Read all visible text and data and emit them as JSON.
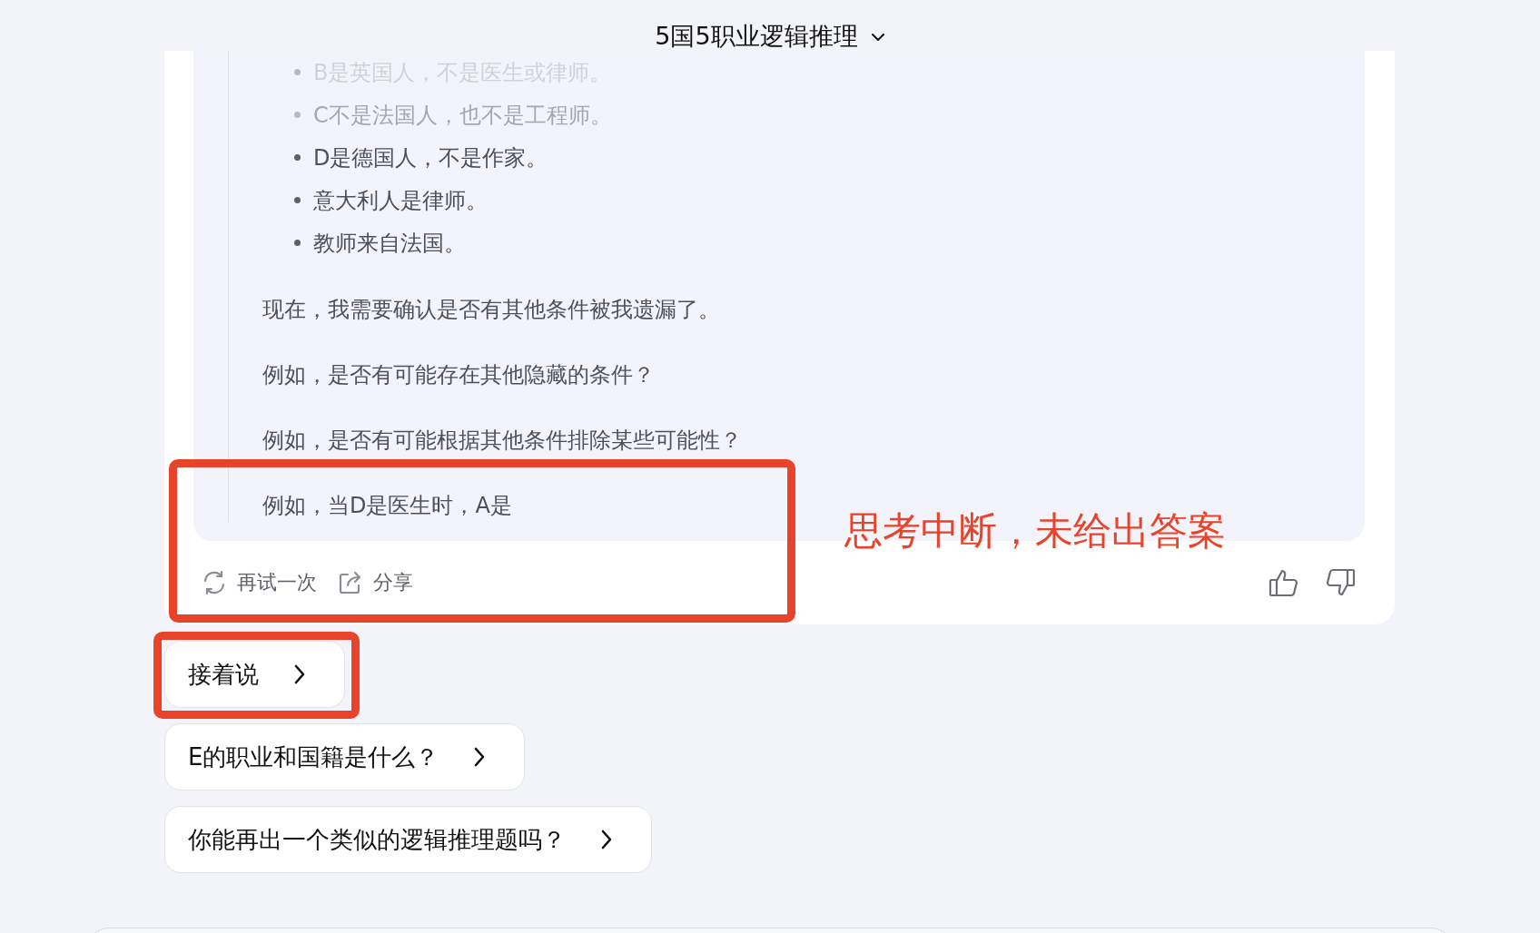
{
  "header": {
    "title": "5国5职业逻辑推理"
  },
  "thinking": {
    "bullets": [
      {
        "text": "B是英国人，不是医生或律师。",
        "faded": true
      },
      {
        "text": "C不是法国人，也不是工程师。",
        "faded": true
      },
      {
        "text": "D是德国人，不是作家。",
        "faded": false
      },
      {
        "text": "意大利人是律师。",
        "faded": false
      },
      {
        "text": "教师来自法国。",
        "faded": false
      }
    ],
    "paragraphs": [
      "现在，我需要确认是否有其他条件被我遗漏了。",
      "例如，是否有可能存在其他隐藏的条件？",
      "例如，是否有可能根据其他条件排除某些可能性？",
      "例如，当D是医生时，A是"
    ]
  },
  "actions": [
    {
      "kind": "retry",
      "label": "再试一次"
    },
    {
      "kind": "share",
      "label": "分享"
    }
  ],
  "feedback": [
    {
      "kind": "like"
    },
    {
      "kind": "dislike"
    }
  ],
  "suggestions": [
    {
      "text": "接着说",
      "highlighted": true
    },
    {
      "text": "E的职业和国籍是什么？",
      "highlighted": false
    },
    {
      "text": "你能再出一个类似的逻辑推理题吗？",
      "highlighted": false
    }
  ],
  "annotation": {
    "text": "思考中断，未给出答案"
  }
}
